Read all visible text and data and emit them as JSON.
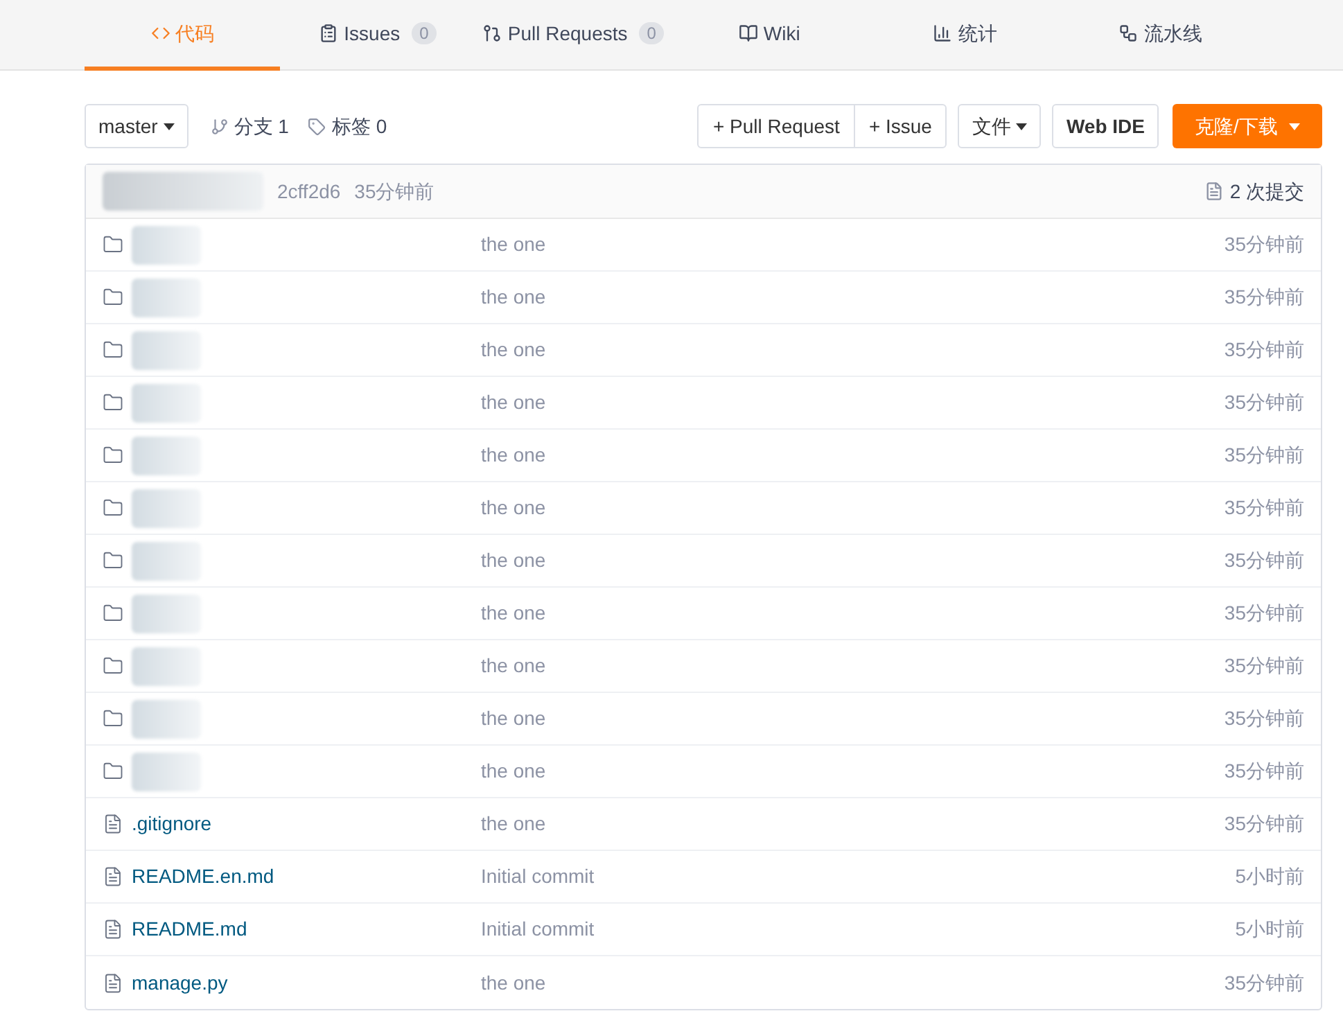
{
  "tabs": [
    {
      "kind": "code",
      "label": "代码",
      "selected": true
    },
    {
      "kind": "issues",
      "label": "Issues",
      "count": "0",
      "selected": false
    },
    {
      "kind": "pulls",
      "label": "Pull Requests",
      "count": "0",
      "selected": false
    },
    {
      "kind": "wiki",
      "label": "Wiki",
      "selected": false
    },
    {
      "kind": "stats",
      "label": "统计",
      "selected": false
    },
    {
      "kind": "pipeline",
      "label": "流水线",
      "selected": false
    }
  ],
  "toolbar": {
    "branch": "master",
    "branches": "分支 1",
    "tags": "标签 0",
    "new_pr": "+ Pull Request",
    "new_issue": "+ Issue",
    "file_menu": "文件",
    "web_ide": "Web IDE",
    "clone": "克隆/下载"
  },
  "last_commit": {
    "author_redacted": true,
    "hash": "2cff2d6",
    "time": "35分钟前",
    "commits": "2 次提交"
  },
  "entries": [
    {
      "kind": "folder",
      "redacted": true,
      "message": "the one",
      "time": "35分钟前"
    },
    {
      "kind": "folder",
      "redacted": true,
      "message": "the one",
      "time": "35分钟前"
    },
    {
      "kind": "folder",
      "redacted": true,
      "message": "the one",
      "time": "35分钟前"
    },
    {
      "kind": "folder",
      "redacted": true,
      "message": "the one",
      "time": "35分钟前"
    },
    {
      "kind": "folder",
      "redacted": true,
      "message": "the one",
      "time": "35分钟前"
    },
    {
      "kind": "folder",
      "redacted": true,
      "message": "the one",
      "time": "35分钟前"
    },
    {
      "kind": "folder",
      "redacted": true,
      "message": "the one",
      "time": "35分钟前"
    },
    {
      "kind": "folder",
      "redacted": true,
      "message": "the one",
      "time": "35分钟前"
    },
    {
      "kind": "folder",
      "redacted": true,
      "message": "the one",
      "time": "35分钟前"
    },
    {
      "kind": "folder",
      "redacted": true,
      "message": "the one",
      "time": "35分钟前"
    },
    {
      "kind": "folder",
      "redacted": true,
      "message": "the one",
      "time": "35分钟前"
    },
    {
      "kind": "file",
      "redacted": false,
      "name": ".gitignore",
      "message": "the one",
      "time": "35分钟前"
    },
    {
      "kind": "file",
      "redacted": false,
      "name": "README.en.md",
      "message": "Initial commit",
      "time": "5小时前"
    },
    {
      "kind": "file",
      "redacted": false,
      "name": "README.md",
      "message": "Initial commit",
      "time": "5小时前"
    },
    {
      "kind": "file",
      "redacted": false,
      "name": "manage.py",
      "message": "the one",
      "time": "35分钟前"
    }
  ]
}
